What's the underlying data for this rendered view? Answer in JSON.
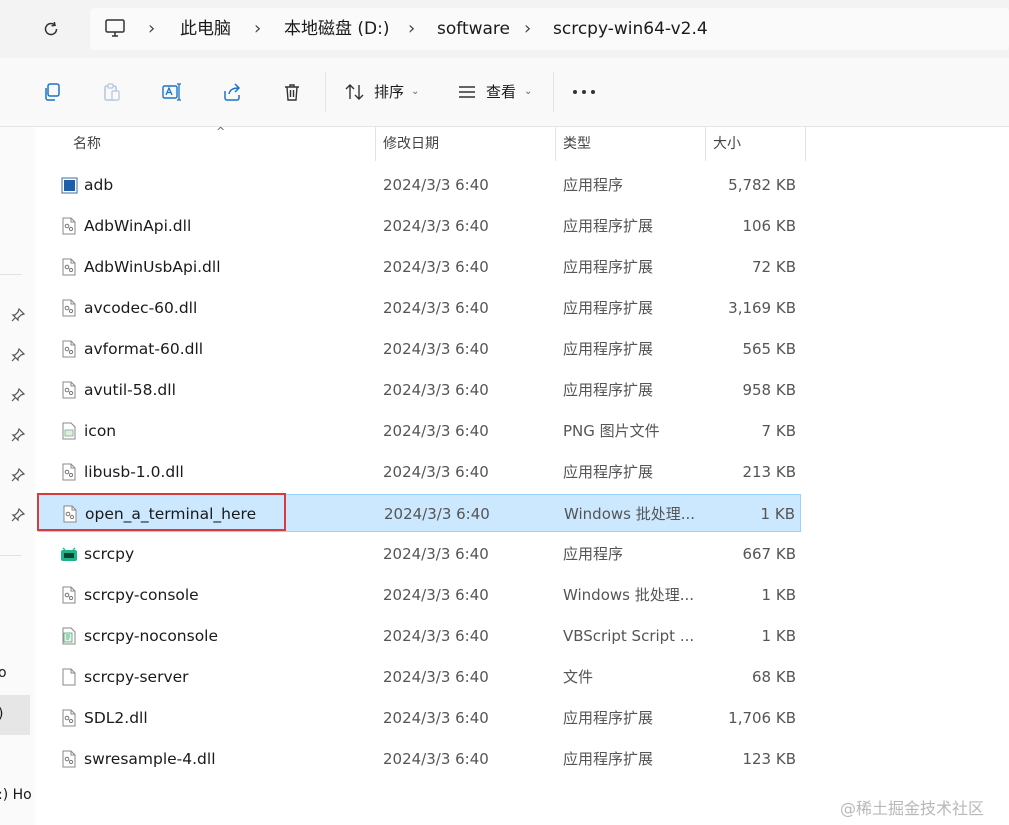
{
  "breadcrumb": {
    "items": [
      "此电脑",
      "本地磁盘 (D:)",
      "software",
      "scrcpy-win64-v2.4"
    ]
  },
  "toolbar": {
    "sort_label": "排序",
    "view_label": "查看",
    "icons": [
      "copy-icon",
      "paste-icon",
      "rename-icon",
      "share-icon",
      "delete-icon",
      "sort-icon",
      "view-icon",
      "more-icon"
    ]
  },
  "columns": {
    "name": "名称",
    "date": "修改日期",
    "type": "类型",
    "size": "大小"
  },
  "files": [
    {
      "name": "adb",
      "date": "2024/3/3 6:40",
      "type": "应用程序",
      "size": "5,782 KB",
      "icon": "exe-adb"
    },
    {
      "name": "AdbWinApi.dll",
      "date": "2024/3/3 6:40",
      "type": "应用程序扩展",
      "size": "106 KB",
      "icon": "dll"
    },
    {
      "name": "AdbWinUsbApi.dll",
      "date": "2024/3/3 6:40",
      "type": "应用程序扩展",
      "size": "72 KB",
      "icon": "dll"
    },
    {
      "name": "avcodec-60.dll",
      "date": "2024/3/3 6:40",
      "type": "应用程序扩展",
      "size": "3,169 KB",
      "icon": "dll"
    },
    {
      "name": "avformat-60.dll",
      "date": "2024/3/3 6:40",
      "type": "应用程序扩展",
      "size": "565 KB",
      "icon": "dll"
    },
    {
      "name": "avutil-58.dll",
      "date": "2024/3/3 6:40",
      "type": "应用程序扩展",
      "size": "958 KB",
      "icon": "dll"
    },
    {
      "name": "icon",
      "date": "2024/3/3 6:40",
      "type": "PNG 图片文件",
      "size": "7 KB",
      "icon": "png"
    },
    {
      "name": "libusb-1.0.dll",
      "date": "2024/3/3 6:40",
      "type": "应用程序扩展",
      "size": "213 KB",
      "icon": "dll"
    },
    {
      "name": "open_a_terminal_here",
      "date": "2024/3/3 6:40",
      "type": "Windows 批处理...",
      "size": "1 KB",
      "icon": "bat",
      "selected": true
    },
    {
      "name": "scrcpy",
      "date": "2024/3/3 6:40",
      "type": "应用程序",
      "size": "667 KB",
      "icon": "exe-scrcpy"
    },
    {
      "name": "scrcpy-console",
      "date": "2024/3/3 6:40",
      "type": "Windows 批处理...",
      "size": "1 KB",
      "icon": "bat"
    },
    {
      "name": "scrcpy-noconsole",
      "date": "2024/3/3 6:40",
      "type": "VBScript Script ...",
      "size": "1 KB",
      "icon": "vbs"
    },
    {
      "name": "scrcpy-server",
      "date": "2024/3/3 6:40",
      "type": "文件",
      "size": "68 KB",
      "icon": "blank"
    },
    {
      "name": "SDL2.dll",
      "date": "2024/3/3 6:40",
      "type": "应用程序扩展",
      "size": "1,706 KB",
      "icon": "dll"
    },
    {
      "name": "swresample-4.dll",
      "date": "2024/3/3 6:40",
      "type": "应用程序扩展",
      "size": "123 KB",
      "icon": "dll"
    }
  ],
  "sidebar": {
    "partial_labels": [
      "o",
      ")",
      ":) Ho"
    ]
  },
  "watermark": "@稀土掘金技术社区",
  "colors": {
    "selection_bg": "#cce8ff",
    "selection_border": "#99d1ff",
    "highlight_box": "#d63c3c",
    "scrcpy_icon": "#1fb389"
  }
}
